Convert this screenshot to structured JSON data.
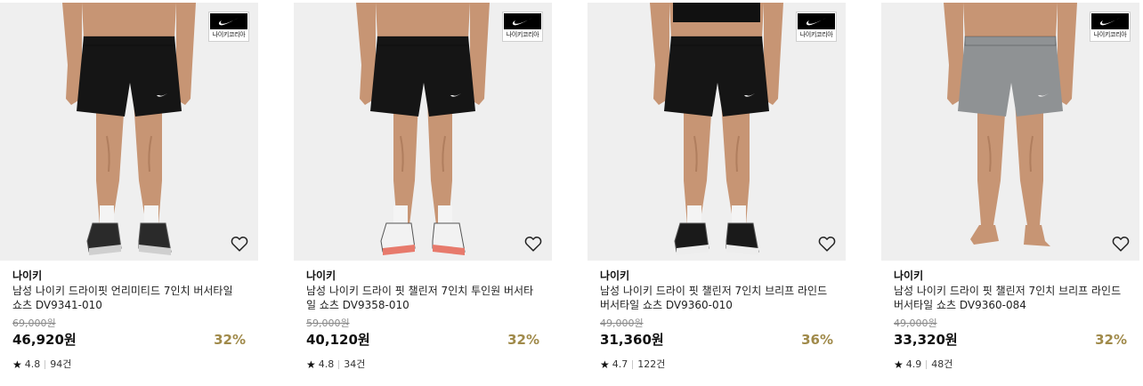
{
  "colors": {
    "discount": "#a08a4a",
    "image_bg": "#efefef",
    "shorts_black": "#151515",
    "shorts_gray": "#8f9294"
  },
  "products": [
    {
      "badge_text": "나이키코리아",
      "brand": "나이키",
      "name": "남성 나이키 드라이핏 언리미티드 7인치 버서타일 쇼츠 DV9341-010",
      "original_price": "69,000원",
      "price": "46,920원",
      "discount": "32%",
      "rating": "4.8",
      "reviews": "94건",
      "star_icon": "star-icon",
      "wish_icon": "heart-outline-icon",
      "shorts_color": "black",
      "shoes": "dark-patterned",
      "pose": "stance-wide"
    },
    {
      "badge_text": "나이키코리아",
      "brand": "나이키",
      "name": "남성 나이키 드라이 핏 챌린저 7인치 투인원 버서타일 쇼츠 DV9358-010",
      "original_price": "59,000원",
      "price": "40,120원",
      "discount": "32%",
      "rating": "4.8",
      "reviews": "34건",
      "star_icon": "star-icon",
      "wish_icon": "heart-outline-icon",
      "shorts_color": "black",
      "shoes": "white-running",
      "pose": "stance-narrow"
    },
    {
      "badge_text": "나이키코리아",
      "brand": "나이키",
      "name": "남성 나이키 드라이 핏 챌린저 7인치 브리프 라인드 버서타일 쇼츠 DV9360-010",
      "original_price": "49,000원",
      "price": "31,360원",
      "discount": "36%",
      "rating": "4.7",
      "reviews": "122건",
      "star_icon": "star-icon",
      "wish_icon": "heart-outline-icon",
      "shorts_color": "black",
      "shoes": "black-running",
      "pose": "stance-wide"
    },
    {
      "badge_text": "나이키코리아",
      "brand": "나이키",
      "name": "남성 나이키 드라이 핏 챌린저 7인치 브리프 라인드 버서타일 쇼츠 DV9360-084",
      "original_price": "49,000원",
      "price": "33,320원",
      "discount": "32%",
      "rating": "4.9",
      "reviews": "48건",
      "star_icon": "star-icon",
      "wish_icon": "heart-outline-icon",
      "shorts_color": "gray",
      "shoes": "barefoot",
      "pose": "stance-wide"
    }
  ]
}
